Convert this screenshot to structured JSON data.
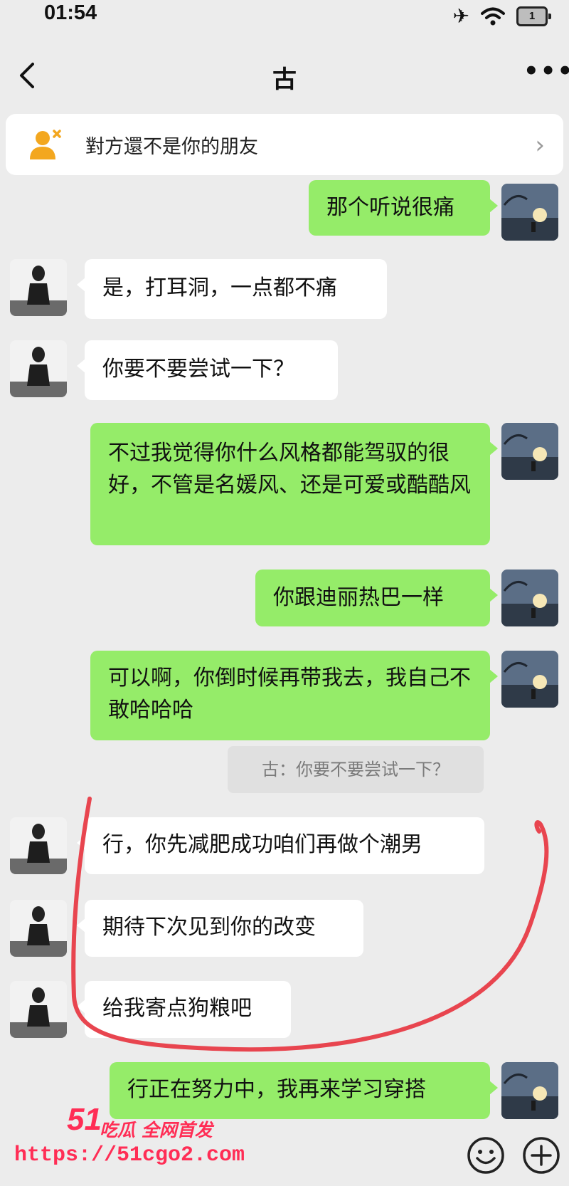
{
  "status": {
    "time": "01:54",
    "battery": "1"
  },
  "header": {
    "title": "古"
  },
  "notice": {
    "text": "對方還不是你的朋友"
  },
  "messages": [
    {
      "from": "me",
      "text": "那个听说很痛"
    },
    {
      "from": "them",
      "text": "是，打耳洞，一点都不痛"
    },
    {
      "from": "them",
      "text": "你要不要尝试一下？"
    },
    {
      "from": "me",
      "text": "不过我觉得你什么风格都能驾驭的很好，不管是名媛风、还是可爱或酷酷风"
    },
    {
      "from": "me",
      "text": "你跟迪丽热巴一样"
    },
    {
      "from": "me",
      "text": "可以啊，你倒时候再带我去，我自己不敢哈哈哈"
    },
    {
      "from": "them",
      "text": "行，你先减肥成功咱们再做个潮男"
    },
    {
      "from": "them",
      "text": "期待下次见到你的改变"
    },
    {
      "from": "them",
      "text": "给我寄点狗粮吧"
    },
    {
      "from": "me",
      "text": "行正在努力中，我再来学习穿搭"
    }
  ],
  "quote": {
    "text": "古：你要不要尝试一下？"
  },
  "watermark": {
    "brand": "51",
    "slogan": "吃瓜 全网首发",
    "url": "https://51cgo2.com"
  },
  "colors": {
    "my_bubble": "#95ec69",
    "their_bubble": "#ffffff",
    "background": "#ececec",
    "annotation": "#e8454f"
  }
}
